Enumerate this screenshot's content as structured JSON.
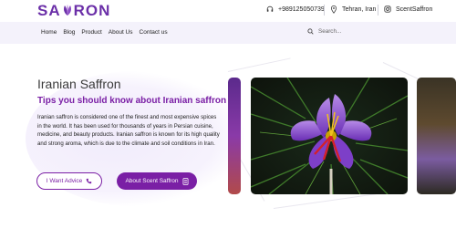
{
  "header": {
    "logo_text": "SAFFRON",
    "logo_prefix": "SA",
    "logo_suffix": "RON",
    "phone": "+989125050739",
    "location": "Tehran, Iran",
    "instagram": "ScentSaffron"
  },
  "nav": {
    "items": [
      "Home",
      "Blog",
      "Product",
      "About Us",
      "Contact us"
    ],
    "search_placeholder": "Search..."
  },
  "hero": {
    "title": "Iranian Saffron",
    "subtitle": "Tips you should know about Iranian saffron",
    "paragraph": "Iranian saffron is considered one of the finest and most expensive spices in the world. It has been used for thousands of years in Persian cuisine, medicine, and beauty products. Iranian saffron is known for its high quality and strong aroma, which is due to the climate and soil conditions in Iran.",
    "button_advice": "I Want Advice",
    "button_about": "About Scent Saffron"
  },
  "colors": {
    "brand_purple": "#7a1fa5",
    "logo_purple": "#6b2fa8",
    "nav_background": "#f4f2fb"
  },
  "icons": {
    "phone": "headset-icon",
    "location": "map-pin-icon",
    "instagram": "instagram-icon",
    "search": "search-icon",
    "advice": "phone-icon",
    "about": "document-icon"
  }
}
